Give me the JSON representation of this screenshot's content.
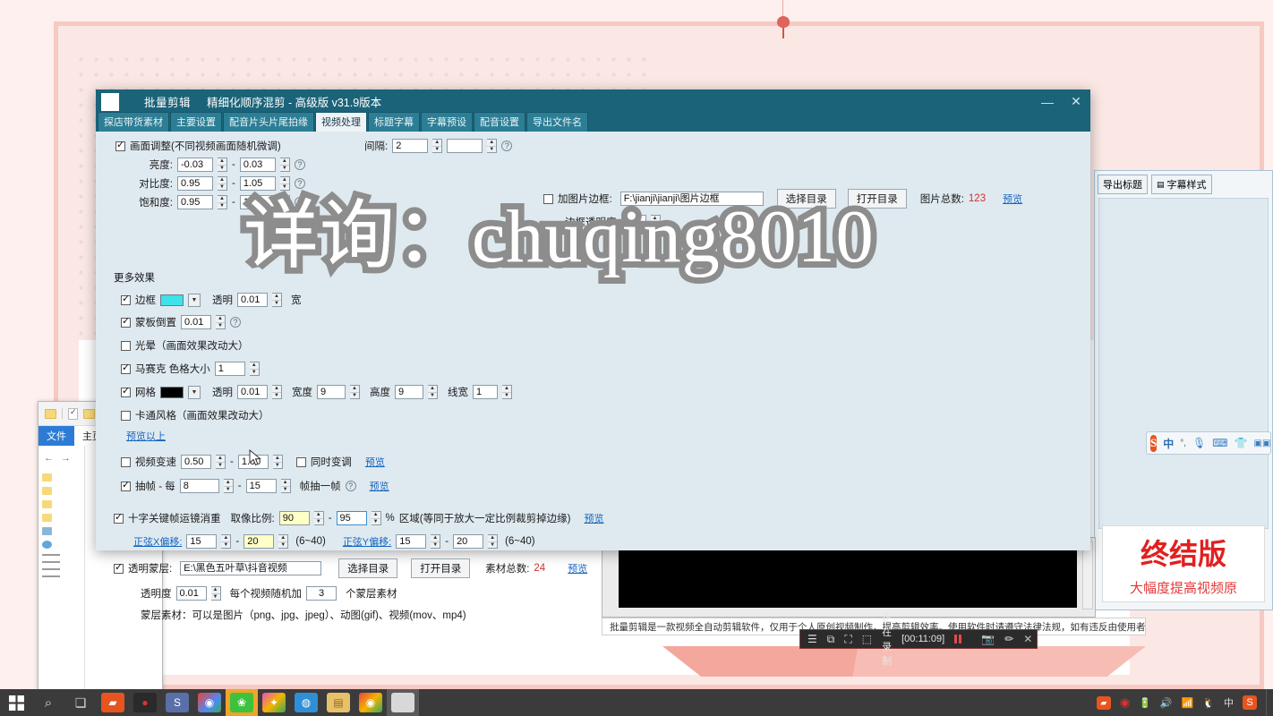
{
  "window": {
    "title": "批量剪辑",
    "subtitle": "精细化顺序混剪 - 高级版  v31.9版本",
    "minimize": "—",
    "close": "✕",
    "tabs": [
      {
        "label": "探店带货素材",
        "active": false
      },
      {
        "label": "主要设置",
        "active": false
      },
      {
        "label": "配音片头片尾拍缘",
        "active": false
      },
      {
        "label": "视频处理",
        "active": true
      },
      {
        "label": "标题字幕",
        "active": false
      },
      {
        "label": "字幕预设",
        "active": false
      },
      {
        "label": "配音设置",
        "active": false
      },
      {
        "label": "导出文件名",
        "active": false
      }
    ]
  },
  "picture_adjust": {
    "checkbox_label": "画面调整(不同视频画面随机微调)",
    "checked": true,
    "rows": [
      {
        "label": "亮度:",
        "min": "-0.03",
        "max": "0.03"
      },
      {
        "label": "对比度:",
        "min": "0.95",
        "max": "1.05"
      },
      {
        "label": "饱和度:",
        "min": "0.95",
        "max": "1.05"
      }
    ],
    "interval_label": "间隔:",
    "interval_value": "2"
  },
  "image_border": {
    "checkbox_label": "加图片边框:",
    "checked": false,
    "path": "F:\\jianji\\jianji\\图片边框",
    "choose_dir": "选择目录",
    "open_dir": "打开目录",
    "count_label": "图片总数:",
    "count_value": "123",
    "preview": "预览",
    "opacity_label": "边框透明度",
    "opacity_value": "1"
  },
  "more_effects": {
    "heading": "更多效果",
    "border": {
      "label": "边框",
      "checked": true,
      "color": "#3ee2ea",
      "alpha_label": "透明",
      "alpha_value": "0.01",
      "width_label": "宽"
    },
    "mask_invert": {
      "label": "蒙板倒置",
      "checked": true,
      "value": "0.01"
    },
    "halo": {
      "label": "光晕（画面效果改动大）",
      "checked": false
    },
    "mosaic": {
      "label": "马赛克 色格大小",
      "checked": true,
      "value": "1"
    },
    "grid": {
      "label": "网格",
      "checked": true,
      "color": "#000000",
      "alpha_label": "透明",
      "alpha_value": "0.01",
      "w_label": "宽度",
      "w_value": "9",
      "h_label": "高度",
      "h_value": "9",
      "line_label": "线宽",
      "line_value": "1"
    },
    "cartoon": {
      "label": "卡通风格（画面效果改动大）",
      "checked": false
    },
    "preview_above": "预览以上"
  },
  "speed": {
    "label": "视频变速",
    "checked": false,
    "min": "0.50",
    "max": "1.00",
    "pitch_label": "同时变调",
    "pitch_checked": false,
    "preview": "预览"
  },
  "frame_drop": {
    "label": "抽帧 - 每",
    "checked": true,
    "min": "8",
    "max": "15",
    "suffix": "帧抽一帧",
    "preview": "预览"
  },
  "keyframe": {
    "label": "十字关键帧运镜消重",
    "checked": true,
    "ratio_label": "取像比例:",
    "ratio_min": "90",
    "ratio_max": "95",
    "unit": "%",
    "note": "区域(等同于放大一定比例裁剪掉边缘)",
    "preview": "预览",
    "x_label": "正弦X偏移:",
    "x_min": "15",
    "x_max": "20",
    "x_range": "(6~40)",
    "y_label": "正弦Y偏移:",
    "y_min": "15",
    "y_max": "20",
    "y_range": "(6~40)"
  },
  "mask_layer": {
    "label": "透明蒙层:",
    "checked": true,
    "path": "E:\\黑色五叶草\\抖音视频",
    "choose_dir": "选择目录",
    "open_dir": "打开目录",
    "count_label": "素材总数:",
    "count_value": "24",
    "preview": "预览",
    "opacity_label": "透明度",
    "opacity_value": "0.01",
    "random_label": "每个视频随机加",
    "random_value": "3",
    "random_suffix": "个蒙层素材",
    "hint": "蒙层素材：可以是图片（png、jpg、jpeg）、动图(gif)、视频(mov、mp4)"
  },
  "watermark": {
    "text": "详询：chuqing8010"
  },
  "right_panel": {
    "tabs": [
      "导出标题",
      "字幕样式"
    ],
    "promo_big": "终结版",
    "promo_sub": "大幅度提高视频原"
  },
  "status_bar": {
    "text": "批量剪辑是一款视频全自动剪辑软件，仅用于个人原创视频制作，提高剪辑效率。使用软件时请遵守法律法规，如有违反由使用者自行承担全部责任!"
  },
  "recorder": {
    "menu_icon": "menu-icon",
    "label": "正在录制",
    "time": "[00:11:09]",
    "pause": "pause-icon",
    "stop": "stop-icon",
    "camera": "camera-icon",
    "pen": "pen-icon",
    "close": "✕"
  },
  "explorer": {
    "tabs": [
      {
        "label": "文件",
        "active": true
      },
      {
        "label": "主页",
        "active": false
      }
    ]
  },
  "ime": {
    "logo": "S",
    "mode": "中",
    "items": [
      "mic-icon",
      "keyboard-icon",
      "skin-icon",
      "apps-icon"
    ],
    "punct": "°,"
  },
  "taskbar": {
    "start": "start-icon",
    "search": "search-icon",
    "taskview": "taskview-icon",
    "apps": [
      {
        "name": "recorder-app",
        "color": "#e8541f",
        "glyph": "▰"
      },
      {
        "name": "record-red-app",
        "color": "#2a2a2a",
        "glyph": "●"
      },
      {
        "name": "sogou-app",
        "color": "#5a6fa8",
        "glyph": "S"
      },
      {
        "name": "chrome-app",
        "color": "#4c8bf5",
        "glyph": "◉"
      },
      {
        "name": "wechat-app",
        "color": "#f0a429",
        "glyph": "❀",
        "active": true
      },
      {
        "name": "colors-app",
        "color": "#7a4fd0",
        "glyph": "✦"
      },
      {
        "name": "browser-app",
        "color": "#2e8fd6",
        "glyph": "◍"
      },
      {
        "name": "folder-app",
        "color": "#e8c06a",
        "glyph": "▤"
      },
      {
        "name": "chrome2-app",
        "color": "#d94c3d",
        "glyph": "◉"
      },
      {
        "name": "window-app",
        "color": "#d8d8d8",
        "glyph": "▢"
      }
    ],
    "tray": [
      "recorder-tray-icon",
      "record-tray-icon",
      "battery-icon",
      "volume-icon",
      "wifi-icon",
      "penguin-icon"
    ],
    "ime_mode": "中",
    "sogou": "S"
  }
}
